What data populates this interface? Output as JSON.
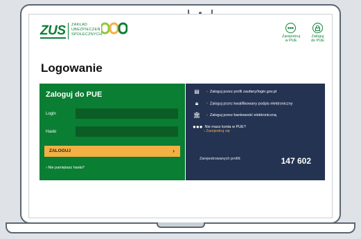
{
  "header": {
    "logo_text": "ZUS",
    "org_line1": "ZAKŁAD",
    "org_line2": "UBEZPIECZEŃ",
    "org_line3": "SPOŁECZNYCH",
    "pue_logo": "PUE",
    "register_label_1": "Zarejestruj",
    "register_label_2": "w PUE",
    "login_label_1": "Zaloguj",
    "login_label_2": "do PUE"
  },
  "page": {
    "title": "Logowanie"
  },
  "login_panel": {
    "title": "Zaloguj do PUE",
    "login_label": "Login",
    "password_label": "Hasło",
    "submit_label": "ZALOGUJ",
    "forgot_label": "Nie pamiętasz hasła?"
  },
  "alt_login": {
    "options": [
      {
        "icon": "id-card-icon",
        "label": "Zaloguj przez profil zaufany/login.gov.pl"
      },
      {
        "icon": "lock-icon",
        "label": "Zaloguj przez kwalifikowany podpis elektroniczny"
      },
      {
        "icon": "bank-icon",
        "label": "Zaloguj przez bankowość elektroniczną"
      }
    ],
    "no_account": "Nie masz konta w PUE?",
    "register_link": "Zarejestruj się",
    "stats_label": "Zarejestrowanych profili:",
    "stats_value": "147 602"
  },
  "colors": {
    "green": "#0a7e33",
    "navy": "#243352",
    "accent": "#f3b043"
  }
}
